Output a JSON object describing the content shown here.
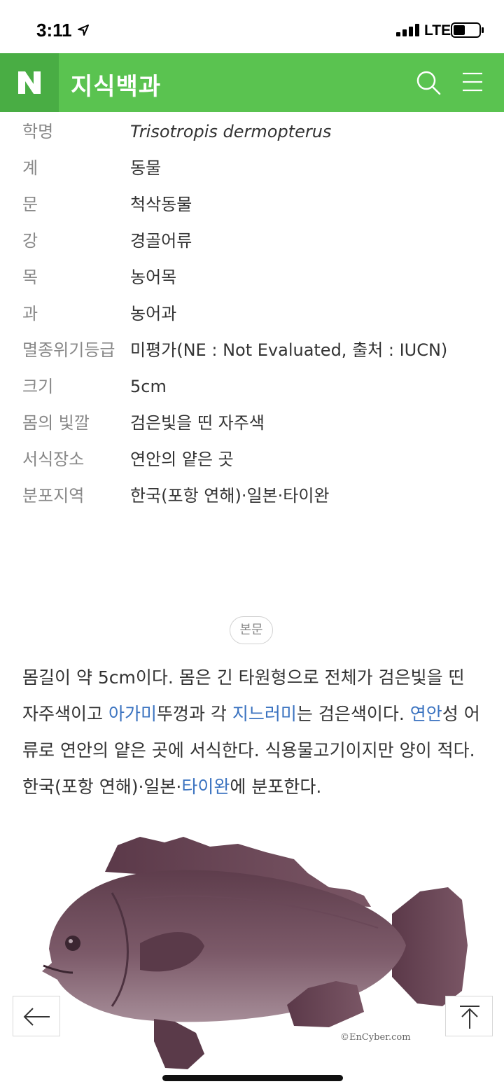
{
  "status_bar": {
    "time": "3:11",
    "network": "LTE"
  },
  "header": {
    "logo": "N",
    "title": "지식백과"
  },
  "info": [
    {
      "label": "학명",
      "value": "Trisotropis dermopterus"
    },
    {
      "label": "계",
      "value": "동물"
    },
    {
      "label": "문",
      "value": "척삭동물"
    },
    {
      "label": "강",
      "value": "경골어류"
    },
    {
      "label": "목",
      "value": "농어목"
    },
    {
      "label": "과",
      "value": "농어과"
    },
    {
      "label": "멸종위기등급",
      "value": "미평가(NE : Not Evaluated, 출처 : IUCN)"
    },
    {
      "label": "크기",
      "value": "5cm"
    },
    {
      "label": "몸의 빛깔",
      "value": "검은빛을 띤 자주색"
    },
    {
      "label": "서식장소",
      "value": "연안의 얕은 곳"
    },
    {
      "label": "분포지역",
      "value": "한국(포항 연해)·일본·타이완"
    }
  ],
  "section_label": "본문",
  "body": {
    "t1": "몸길이 약 5cm이다. 몸은 긴 타원형으로 전체가 검은빛을 띤 자주색이고 ",
    "link1": "아가미",
    "t2": "뚜껑과 각 ",
    "link2": "지느러미",
    "t3": "는 검은색이다. ",
    "link3": "연안",
    "t4": "성 어류로 연안의 얕은 곳에 서식한다. 식용물고기이지만 양이 적다. 한국(포항 연해)·일본·",
    "link4": "타이완",
    "t5": "에 분포한다."
  },
  "image": {
    "credit": "©EnCyber.com"
  },
  "colors": {
    "header_green": "#5ac350",
    "logo_green": "#49ad44",
    "link_blue": "#3b73c0",
    "fish_purple": "#6e4e5c"
  },
  "icons": [
    "location-arrow-icon",
    "signal-icon",
    "battery-icon",
    "search-icon",
    "menu-icon",
    "arrow-left-icon",
    "arrow-up-icon"
  ]
}
